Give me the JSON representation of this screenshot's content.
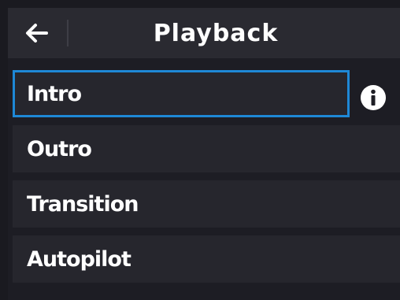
{
  "header": {
    "title": "Playback",
    "back_icon": "arrow-left-icon"
  },
  "menu": {
    "items": [
      {
        "label": "Intro",
        "selected": true
      },
      {
        "label": "Outro",
        "selected": false
      },
      {
        "label": "Transition",
        "selected": false
      },
      {
        "label": "Autopilot",
        "selected": false
      }
    ],
    "info_icon": "info-icon"
  },
  "colors": {
    "background": "#1a1a20",
    "header": "#2a2a31",
    "item": "#26262d",
    "focus_border": "#1e88d6",
    "text": "#ffffff"
  }
}
